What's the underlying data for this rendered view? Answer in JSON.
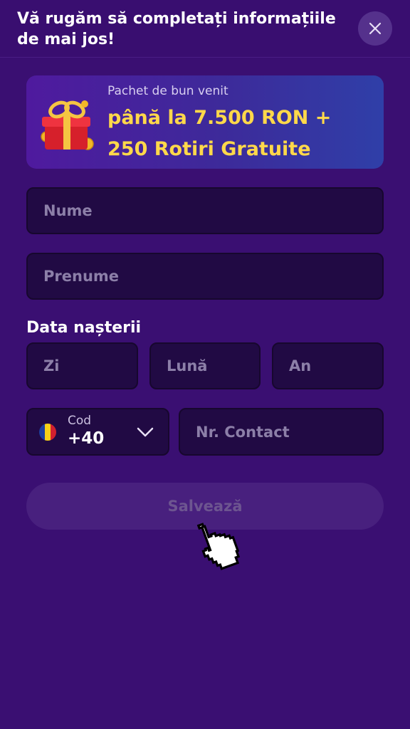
{
  "header": {
    "title": "Vă rugăm să completați informațiile de mai jos!",
    "close_icon": "close-icon"
  },
  "banner": {
    "subtitle": "Pachet de bun venit",
    "offer": "până la 7.500 RON + 250 Rotiri Gratuite",
    "icon": "gift-icon"
  },
  "form": {
    "first_name_placeholder": "Nume",
    "last_name_placeholder": "Prenume",
    "dob_label": "Data nașterii",
    "day_placeholder": "Zi",
    "month_placeholder": "Lună",
    "year_placeholder": "An",
    "phone_code_label": "Cod",
    "phone_code_value": "+40",
    "phone_placeholder": "Nr. Contact",
    "flag_icon": "romania-flag-icon"
  },
  "actions": {
    "save_label": "Salvează"
  },
  "colors": {
    "background": "#3a0f72",
    "field": "#210a44",
    "offer_text": "#ffd84a",
    "button_disabled": "#48207e"
  }
}
